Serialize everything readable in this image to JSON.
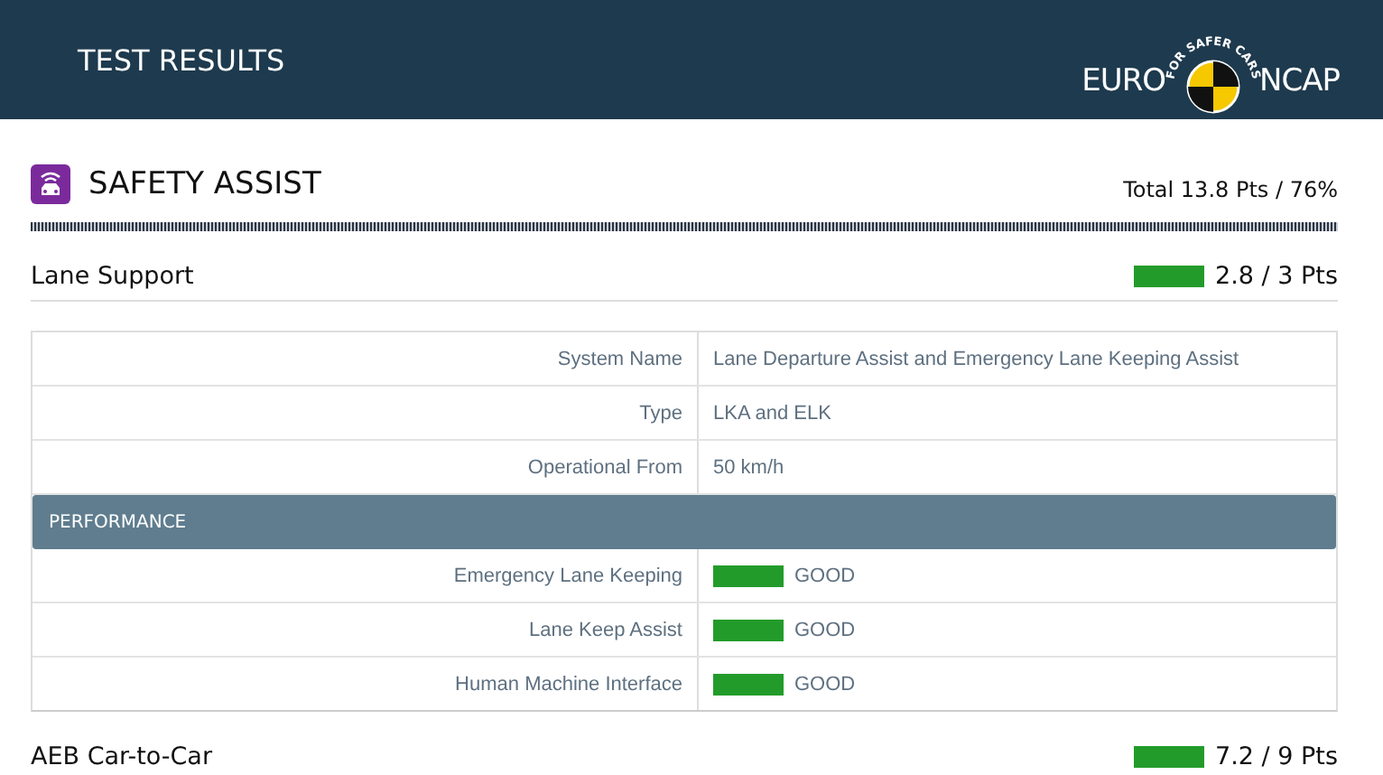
{
  "header": {
    "title": "TEST RESULTS",
    "logo": {
      "left": "EURO",
      "right": "NCAP",
      "tagline": "FOR SAFER CARS"
    }
  },
  "section": {
    "title": "SAFETY ASSIST",
    "total": "Total 13.8 Pts / 76%"
  },
  "categories": [
    {
      "name": "Lane Support",
      "score": "2.8 / 3 Pts",
      "color": "#239b2b",
      "details": [
        {
          "label": "System Name",
          "value": "Lane Departure Assist and Emergency Lane Keeping Assist"
        },
        {
          "label": "Type",
          "value": "LKA and ELK"
        },
        {
          "label": "Operational From",
          "value": "50 km/h"
        }
      ],
      "performance_title": "PERFORMANCE",
      "performance": [
        {
          "label": "Emergency Lane Keeping",
          "rating": "GOOD",
          "color": "#239b2b"
        },
        {
          "label": "Lane Keep Assist",
          "rating": "GOOD",
          "color": "#239b2b"
        },
        {
          "label": "Human Machine Interface",
          "rating": "GOOD",
          "color": "#239b2b"
        }
      ]
    },
    {
      "name": "AEB Car-to-Car",
      "score": "7.2 / 9 Pts",
      "color": "#239b2b"
    }
  ]
}
